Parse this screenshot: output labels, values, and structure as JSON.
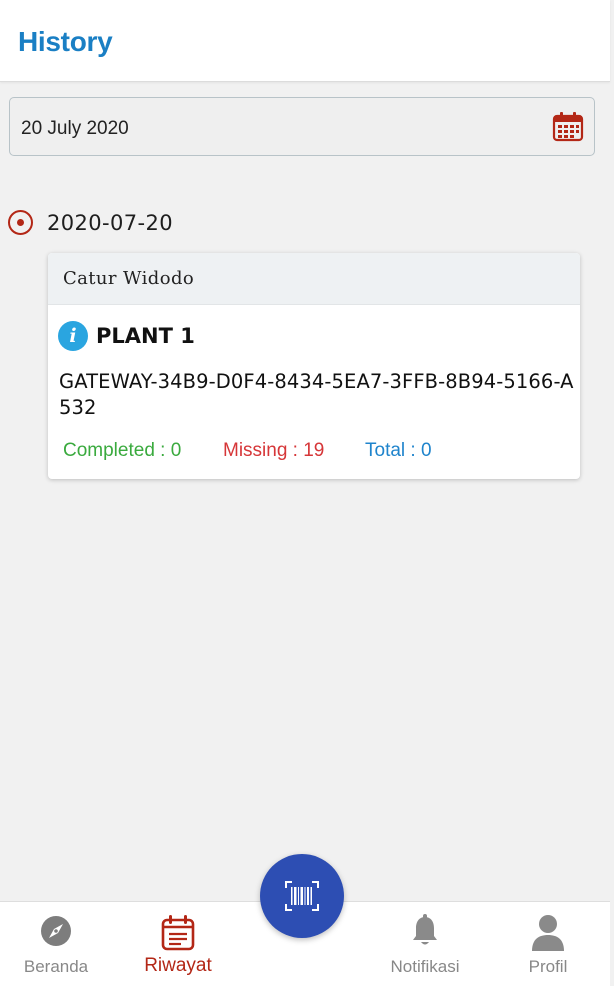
{
  "header": {
    "title": "History"
  },
  "date_filter": {
    "value": "20 July 2020",
    "icon": "calendar-icon"
  },
  "history": {
    "groups": [
      {
        "date": "2020-07-20",
        "cards": [
          {
            "user": "Catur Widodo",
            "plant": "PLANT 1",
            "gateway": "GATEWAY-34B9-D0F4-8434-5EA7-3FFB-8B94-5166-A532",
            "completed_label": "Completed : 0",
            "missing_label": "Missing : 19",
            "total_label": "Total : 0"
          }
        ]
      }
    ]
  },
  "bottom_nav": {
    "items": [
      {
        "label": "Beranda",
        "icon": "compass-icon"
      },
      {
        "label": "Riwayat",
        "icon": "calendar-icon",
        "active": true
      },
      {
        "label": "Notifikasi",
        "icon": "bell-icon"
      },
      {
        "label": "Profil",
        "icon": "person-icon"
      }
    ],
    "fab_icon": "barcode-scan-icon"
  },
  "colors": {
    "accent": "#1a7fc4",
    "active": "#b32716",
    "fab": "#2d4eb3",
    "completed": "#3aaa3e",
    "missing": "#d63638",
    "total": "#1f84cc"
  }
}
